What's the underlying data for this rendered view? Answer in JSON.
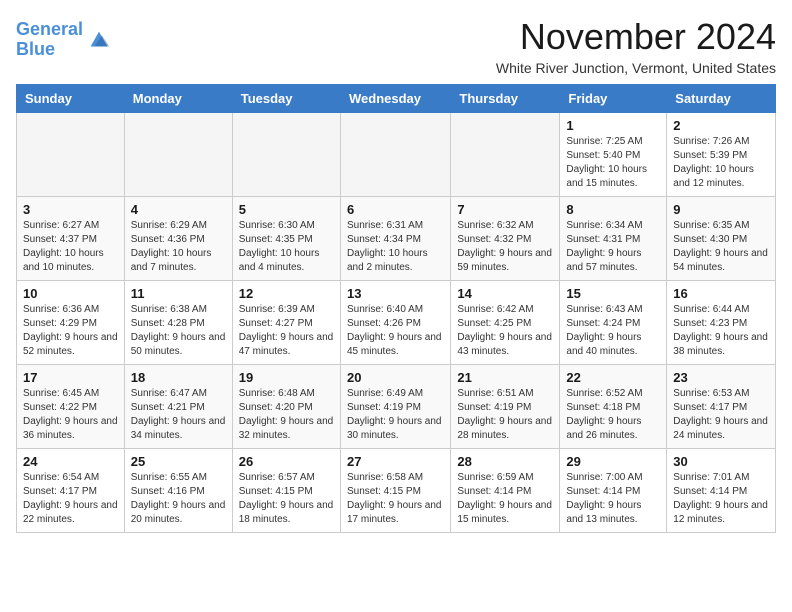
{
  "logo": {
    "line1": "General",
    "line2": "Blue"
  },
  "title": "November 2024",
  "subtitle": "White River Junction, Vermont, United States",
  "days_of_week": [
    "Sunday",
    "Monday",
    "Tuesday",
    "Wednesday",
    "Thursday",
    "Friday",
    "Saturday"
  ],
  "weeks": [
    [
      {
        "day": "",
        "info": ""
      },
      {
        "day": "",
        "info": ""
      },
      {
        "day": "",
        "info": ""
      },
      {
        "day": "",
        "info": ""
      },
      {
        "day": "",
        "info": ""
      },
      {
        "day": "1",
        "info": "Sunrise: 7:25 AM\nSunset: 5:40 PM\nDaylight: 10 hours and 15 minutes."
      },
      {
        "day": "2",
        "info": "Sunrise: 7:26 AM\nSunset: 5:39 PM\nDaylight: 10 hours and 12 minutes."
      }
    ],
    [
      {
        "day": "3",
        "info": "Sunrise: 6:27 AM\nSunset: 4:37 PM\nDaylight: 10 hours and 10 minutes."
      },
      {
        "day": "4",
        "info": "Sunrise: 6:29 AM\nSunset: 4:36 PM\nDaylight: 10 hours and 7 minutes."
      },
      {
        "day": "5",
        "info": "Sunrise: 6:30 AM\nSunset: 4:35 PM\nDaylight: 10 hours and 4 minutes."
      },
      {
        "day": "6",
        "info": "Sunrise: 6:31 AM\nSunset: 4:34 PM\nDaylight: 10 hours and 2 minutes."
      },
      {
        "day": "7",
        "info": "Sunrise: 6:32 AM\nSunset: 4:32 PM\nDaylight: 9 hours and 59 minutes."
      },
      {
        "day": "8",
        "info": "Sunrise: 6:34 AM\nSunset: 4:31 PM\nDaylight: 9 hours and 57 minutes."
      },
      {
        "day": "9",
        "info": "Sunrise: 6:35 AM\nSunset: 4:30 PM\nDaylight: 9 hours and 54 minutes."
      }
    ],
    [
      {
        "day": "10",
        "info": "Sunrise: 6:36 AM\nSunset: 4:29 PM\nDaylight: 9 hours and 52 minutes."
      },
      {
        "day": "11",
        "info": "Sunrise: 6:38 AM\nSunset: 4:28 PM\nDaylight: 9 hours and 50 minutes."
      },
      {
        "day": "12",
        "info": "Sunrise: 6:39 AM\nSunset: 4:27 PM\nDaylight: 9 hours and 47 minutes."
      },
      {
        "day": "13",
        "info": "Sunrise: 6:40 AM\nSunset: 4:26 PM\nDaylight: 9 hours and 45 minutes."
      },
      {
        "day": "14",
        "info": "Sunrise: 6:42 AM\nSunset: 4:25 PM\nDaylight: 9 hours and 43 minutes."
      },
      {
        "day": "15",
        "info": "Sunrise: 6:43 AM\nSunset: 4:24 PM\nDaylight: 9 hours and 40 minutes."
      },
      {
        "day": "16",
        "info": "Sunrise: 6:44 AM\nSunset: 4:23 PM\nDaylight: 9 hours and 38 minutes."
      }
    ],
    [
      {
        "day": "17",
        "info": "Sunrise: 6:45 AM\nSunset: 4:22 PM\nDaylight: 9 hours and 36 minutes."
      },
      {
        "day": "18",
        "info": "Sunrise: 6:47 AM\nSunset: 4:21 PM\nDaylight: 9 hours and 34 minutes."
      },
      {
        "day": "19",
        "info": "Sunrise: 6:48 AM\nSunset: 4:20 PM\nDaylight: 9 hours and 32 minutes."
      },
      {
        "day": "20",
        "info": "Sunrise: 6:49 AM\nSunset: 4:19 PM\nDaylight: 9 hours and 30 minutes."
      },
      {
        "day": "21",
        "info": "Sunrise: 6:51 AM\nSunset: 4:19 PM\nDaylight: 9 hours and 28 minutes."
      },
      {
        "day": "22",
        "info": "Sunrise: 6:52 AM\nSunset: 4:18 PM\nDaylight: 9 hours and 26 minutes."
      },
      {
        "day": "23",
        "info": "Sunrise: 6:53 AM\nSunset: 4:17 PM\nDaylight: 9 hours and 24 minutes."
      }
    ],
    [
      {
        "day": "24",
        "info": "Sunrise: 6:54 AM\nSunset: 4:17 PM\nDaylight: 9 hours and 22 minutes."
      },
      {
        "day": "25",
        "info": "Sunrise: 6:55 AM\nSunset: 4:16 PM\nDaylight: 9 hours and 20 minutes."
      },
      {
        "day": "26",
        "info": "Sunrise: 6:57 AM\nSunset: 4:15 PM\nDaylight: 9 hours and 18 minutes."
      },
      {
        "day": "27",
        "info": "Sunrise: 6:58 AM\nSunset: 4:15 PM\nDaylight: 9 hours and 17 minutes."
      },
      {
        "day": "28",
        "info": "Sunrise: 6:59 AM\nSunset: 4:14 PM\nDaylight: 9 hours and 15 minutes."
      },
      {
        "day": "29",
        "info": "Sunrise: 7:00 AM\nSunset: 4:14 PM\nDaylight: 9 hours and 13 minutes."
      },
      {
        "day": "30",
        "info": "Sunrise: 7:01 AM\nSunset: 4:14 PM\nDaylight: 9 hours and 12 minutes."
      }
    ]
  ]
}
